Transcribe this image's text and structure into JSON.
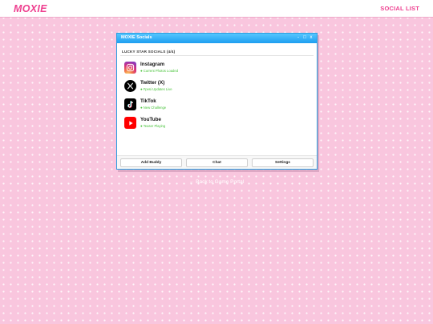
{
  "header": {
    "brand": "MOXIE",
    "nav_link": "SOCIAL LIST"
  },
  "window": {
    "title": "MOXIE Socials",
    "controls": {
      "minimize": "-",
      "maximize": "□",
      "close": "x"
    },
    "section_heading": "LUCKY STAR SOCIALS (4/4)",
    "socials": [
      {
        "name": "Instagram",
        "status": "Current Photos Loaded",
        "icon": "instagram-icon",
        "status_color": "#48c33a"
      },
      {
        "name": "Twitter (X)",
        "status": "Fpesi Updates Live",
        "icon": "x-twitter-icon",
        "status_color": "#48c33a"
      },
      {
        "name": "TikTok",
        "status": "New Challenge",
        "icon": "tiktok-icon",
        "status_color": "#48c33a"
      },
      {
        "name": "YouTube",
        "status": "Teaser Playing",
        "icon": "youtube-icon",
        "status_color": "#48c33a"
      }
    ],
    "buttons": {
      "add_buddy": "Add Buddy",
      "chat": "Chat",
      "settings": "Settings"
    }
  },
  "back_link": "← Back to Game Portal",
  "colors": {
    "accent": "#ee3f8f",
    "page_background": "#f9c6de",
    "titlebar": "#1e9ef0",
    "status_online": "#48c33a"
  }
}
